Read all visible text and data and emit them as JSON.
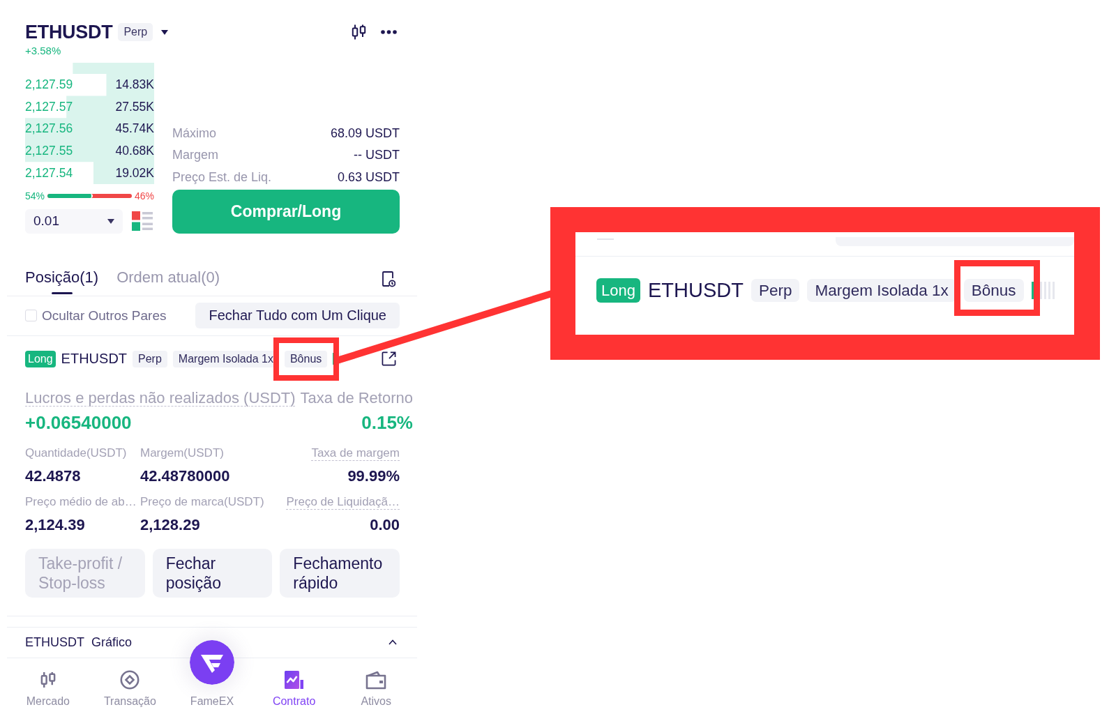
{
  "header": {
    "symbol": "ETHUSDT",
    "tag": "Perp",
    "change": "+3.58%"
  },
  "order_book": {
    "rows": [
      {
        "price": "2,127.59",
        "quantity": "14.83K"
      },
      {
        "price": "2,127.57",
        "quantity": "27.55K"
      },
      {
        "price": "2,127.56",
        "quantity": "45.74K"
      },
      {
        "price": "2,127.55",
        "quantity": "40.68K"
      },
      {
        "price": "2,127.54",
        "quantity": "19.02K"
      }
    ],
    "ratio": {
      "buy": "54%",
      "sell": "46%",
      "level": 0.54
    },
    "precision": "0.01"
  },
  "order_info": [
    {
      "label": "Máximo",
      "value": "68.09 USDT"
    },
    {
      "label": "Margem",
      "value": "-- USDT"
    },
    {
      "label": "Preço Est. de Liq.",
      "value": "0.63 USDT"
    }
  ],
  "buy_button": "Comprar/Long",
  "tabs": [
    {
      "label": "Posição(1)",
      "selected": true
    },
    {
      "label": "Ordem atual(0)",
      "selected": false
    }
  ],
  "filter": {
    "hide_other_pairs": {
      "label": "Ocultar Outros Pares",
      "checked": false
    },
    "close_all_button": "Fechar Tudo com Um Clique"
  },
  "position": {
    "side": {
      "label": "Long",
      "kind": "long"
    },
    "symbol": "ETHUSDT",
    "tags": [
      {
        "label": "Perp",
        "highlighted": false
      },
      {
        "label": "Margem Isolada 1x",
        "highlighted": false
      },
      {
        "label": "Bônus",
        "highlighted": true
      }
    ],
    "pnl": [
      {
        "label": "Lucros e perdas não realizados (USDT)",
        "value": "+0.06540000",
        "dotted": true
      },
      {
        "label": "Taxa de Retorno",
        "value": "0.15%",
        "dotted": false
      }
    ],
    "metrics": [
      {
        "label": "Quantidade(USDT)",
        "value": "42.4878",
        "dotted": false
      },
      {
        "label": "Margem(USDT)",
        "value": "42.48780000",
        "dotted": false
      },
      {
        "label": "Taxa de margem",
        "value": "99.99%",
        "dotted": true
      },
      {
        "label": "Preço médio de ab…",
        "value": "2,124.39",
        "dotted": false
      },
      {
        "label": "Preço de marca(USDT)",
        "value": "2,128.29",
        "dotted": false
      },
      {
        "label": "Preço de Liquidaçã…",
        "value": "0.00",
        "dotted": true
      }
    ],
    "actions": [
      {
        "label": "Take-profit / Stop-loss",
        "disabled": true
      },
      {
        "label": "Fechar posição",
        "disabled": false
      },
      {
        "label": "Fechamento rápido",
        "disabled": false
      }
    ]
  },
  "chart_section": {
    "symbol": "ETHUSDT",
    "label": "Gráfico",
    "expanded": true
  },
  "bottom_nav": [
    {
      "label": "Mercado",
      "kind": "market",
      "selected": false
    },
    {
      "label": "Transação",
      "kind": "trade",
      "selected": false
    },
    {
      "label": "FameEX",
      "kind": "home",
      "selected": false
    },
    {
      "label": "Contrato",
      "kind": "contract",
      "selected": true
    },
    {
      "label": "Ativos",
      "kind": "assets",
      "selected": false
    }
  ],
  "callout": {
    "side": {
      "label": "Long",
      "kind": "long"
    },
    "symbol": "ETHUSDT",
    "tags": [
      {
        "label": "Perp",
        "highlighted": false
      },
      {
        "label": "Margem Isolada 1x",
        "highlighted": false
      },
      {
        "label": "Bônus",
        "highlighted": true
      }
    ]
  }
}
